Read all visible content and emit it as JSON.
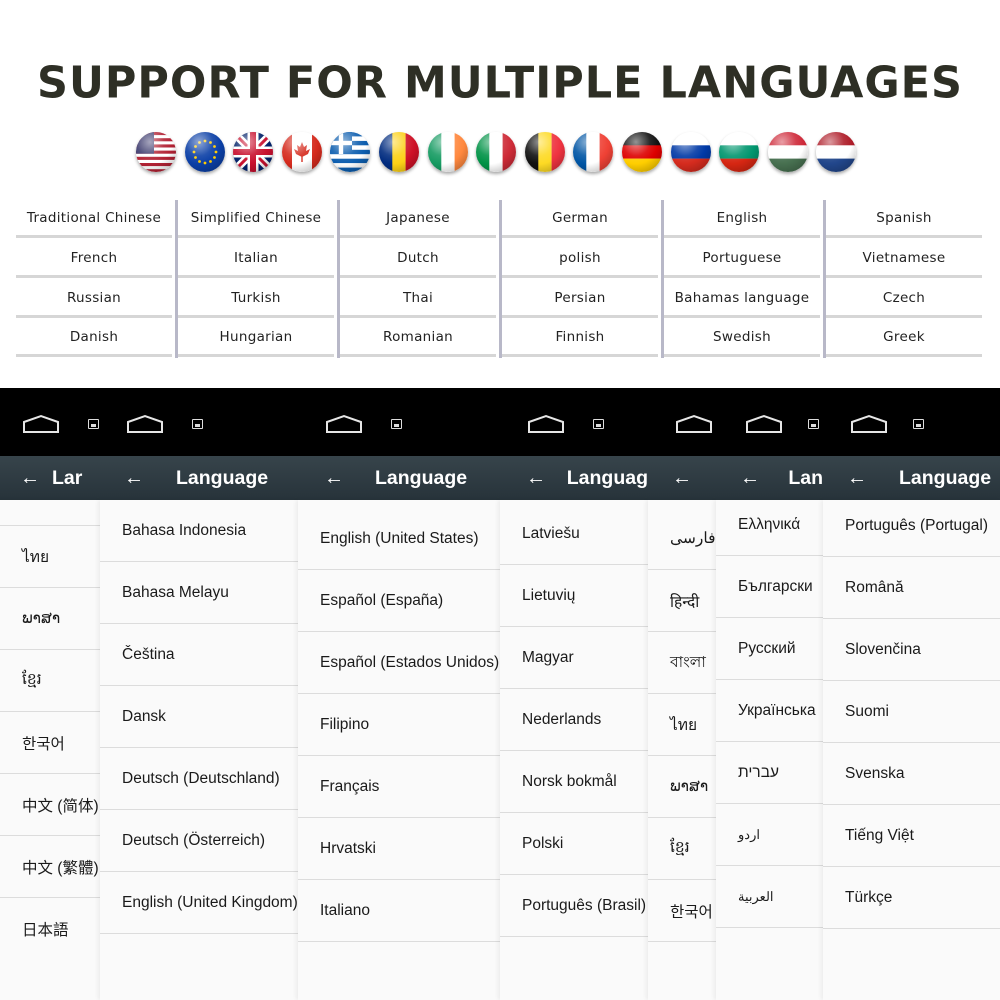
{
  "banner": {
    "title": "SUPPORT FOR MULTIPLE LANGUAGES"
  },
  "flags": [
    {
      "name": "usa-flag",
      "colors": [
        "#b22234",
        "#ffffff",
        "#3c3b6e"
      ]
    },
    {
      "name": "eu-flag",
      "colors": [
        "#003399",
        "#ffcc00"
      ]
    },
    {
      "name": "uk-flag",
      "colors": [
        "#012169",
        "#ffffff",
        "#c8102e"
      ]
    },
    {
      "name": "canada-flag",
      "colors": [
        "#d52b1e",
        "#ffffff"
      ]
    },
    {
      "name": "greece-flag",
      "colors": [
        "#0d5eaf",
        "#ffffff"
      ]
    },
    {
      "name": "romania-flag",
      "colors": [
        "#002b7f",
        "#fcd116",
        "#ce1126"
      ]
    },
    {
      "name": "ireland-flag",
      "colors": [
        "#169b62",
        "#ffffff",
        "#ff883e"
      ]
    },
    {
      "name": "italy-flag",
      "colors": [
        "#009246",
        "#ffffff",
        "#ce2b37"
      ]
    },
    {
      "name": "belgium-flag",
      "colors": [
        "#000000",
        "#fdda24",
        "#ef3340"
      ]
    },
    {
      "name": "france-flag",
      "colors": [
        "#0055a4",
        "#ffffff",
        "#ef4135"
      ]
    },
    {
      "name": "germany-flag",
      "colors": [
        "#000000",
        "#dd0000",
        "#ffce00"
      ]
    },
    {
      "name": "russia-flag",
      "colors": [
        "#ffffff",
        "#0039a6",
        "#d52b1e"
      ]
    },
    {
      "name": "bulgaria-flag",
      "colors": [
        "#ffffff",
        "#00966e",
        "#d62612"
      ]
    },
    {
      "name": "hungary-flag",
      "colors": [
        "#ce2939",
        "#ffffff",
        "#477050"
      ]
    },
    {
      "name": "netherlands-flag",
      "colors": [
        "#ae1c28",
        "#ffffff",
        "#21468b"
      ]
    }
  ],
  "language_table": [
    [
      "Traditional Chinese",
      "French",
      "Russian",
      "Danish"
    ],
    [
      "Simplified Chinese",
      "Italian",
      "Turkish",
      "Hungarian"
    ],
    [
      "Japanese",
      "Dutch",
      "Thai",
      "Romanian"
    ],
    [
      "German",
      "polish",
      "Persian",
      "Finnish"
    ],
    [
      "English",
      "Portuguese",
      "Bahamas language",
      "Swedish"
    ],
    [
      "Spanish",
      "Vietnamese",
      "Czech",
      "Greek"
    ]
  ],
  "screens": [
    {
      "back_icon": "←",
      "title": "Lar",
      "items": [
        "ไทย",
        "ພາສາ",
        "ខ្មែរ",
        "한국어",
        "中文 (简体)",
        "中文 (繁體)",
        "日本語"
      ]
    },
    {
      "back_icon": "←",
      "title": "Language",
      "items": [
        "Bahasa Indonesia",
        "Bahasa Melayu",
        "Čeština",
        "Dansk",
        "Deutsch (Deutschland)",
        "Deutsch (Österreich)",
        "English (United Kingdom)"
      ]
    },
    {
      "back_icon": "←",
      "title": "Language",
      "items": [
        "English (United States)",
        "Español (España)",
        "Español (Estados Unidos)",
        "Filipino",
        "Français",
        "Hrvatski",
        "Italiano"
      ]
    },
    {
      "back_icon": "←",
      "title": "Languag",
      "items": [
        "Latviešu",
        "Lietuvių",
        "Magyar",
        "Nederlands",
        "Norsk bokmål",
        "Polski",
        "Português (Brasil)"
      ]
    },
    {
      "back_icon": "←",
      "title": "",
      "items": [
        "فارسی",
        "हिन्दी",
        "বাংলা",
        "ไทย",
        "ພາສາ",
        "ខ្មែរ",
        "한국어"
      ]
    },
    {
      "back_icon": "←",
      "title": "Lan",
      "items": [
        "Ελληνικά",
        "Български",
        "Русский",
        "Українська",
        "עברית",
        "اردو",
        "العربية"
      ]
    },
    {
      "back_icon": "←",
      "title": "Language",
      "items": [
        "Português (Portugal)",
        "Română",
        "Slovenčina",
        "Suomi",
        "Svenska",
        "Tiếng Việt",
        "Türkçe"
      ]
    }
  ],
  "colors": {
    "title_text": "#2e2f25",
    "nav_strip": "#000000",
    "header_bar": "#2f3c43",
    "list_bg": "#fafafa",
    "divider": "#dcdcdc"
  }
}
